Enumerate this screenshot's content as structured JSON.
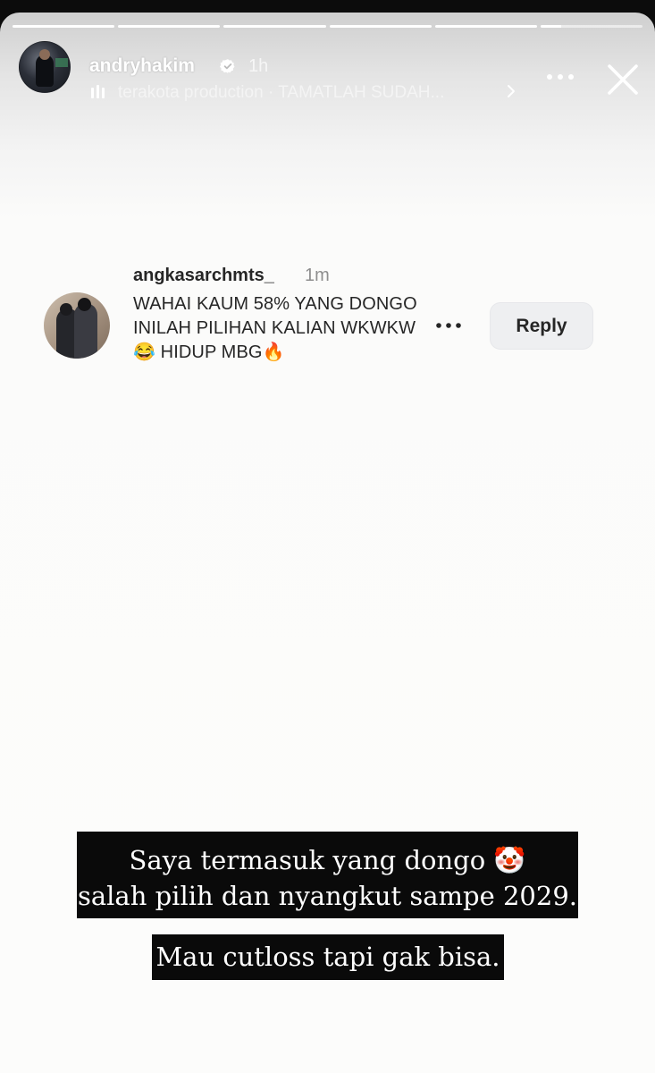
{
  "story": {
    "progress": [
      1,
      1,
      1,
      1,
      1,
      0.2
    ],
    "author": {
      "username": "andryhakim",
      "verified": true,
      "time_ago": "1h",
      "avatar_icon": "profile-photo"
    },
    "music": {
      "icon": "audio-bars-icon",
      "text": "terakota production · TAMATLAH SUDAH..."
    },
    "actions": {
      "more_icon": "more-horizontal-icon",
      "close_icon": "close-icon"
    }
  },
  "comment": {
    "username": "angkasarchmts_",
    "time_ago": "1m",
    "text": "WAHAI KAUM 58% YANG DONGO INILAH PILIHAN KALIAN WKWKW😂 HIDUP MBG🔥",
    "more_icon": "more-horizontal-icon",
    "reply_label": "Reply"
  },
  "captions": {
    "line1": "Saya termasuk yang dongo 🤡",
    "line2": "salah pilih dan nyangkut sampe 2029.",
    "line3": "Mau cutloss tapi gak bisa."
  },
  "colors": {
    "verified_badge": "#ffffff",
    "caption_bg": "#0a0a0a",
    "reply_bg": "#eeeff1"
  }
}
